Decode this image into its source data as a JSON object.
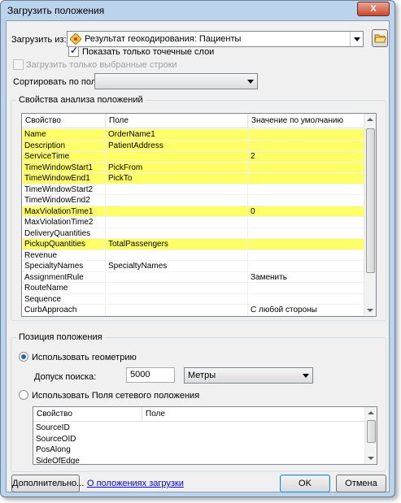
{
  "window": {
    "title": "Загрузить положения",
    "close_label": "X"
  },
  "load_from": {
    "label": "Загрузить из:",
    "value": "Результат геокодирования: Пациенты",
    "icon": "geocode-layer-icon"
  },
  "show_point_layers": {
    "label": "Показать только точечные слои",
    "checked": true
  },
  "load_selected_only": {
    "label": "Загрузить только выбранные строки",
    "checked": false,
    "enabled": false
  },
  "sort_by": {
    "label": "Сортировать по полю:",
    "value": ""
  },
  "properties_group": {
    "title": "Свойства анализа положений",
    "columns": [
      "Свойство",
      "Поле",
      "Значение по умолчанию"
    ],
    "rows": [
      {
        "property": "Name",
        "field": "OrderName1",
        "default": "",
        "highlight": true
      },
      {
        "property": "Description",
        "field": "PatientAddress",
        "default": "",
        "highlight": true
      },
      {
        "property": "ServiceTime",
        "field": "",
        "default": "2",
        "highlight": true
      },
      {
        "property": "TimeWindowStart1",
        "field": "PickFrom",
        "default": "",
        "highlight": true
      },
      {
        "property": "TimeWindowEnd1",
        "field": "PickTo",
        "default": "",
        "highlight": true
      },
      {
        "property": "TimeWindowStart2",
        "field": "",
        "default": "",
        "highlight": false
      },
      {
        "property": "TimeWindowEnd2",
        "field": "",
        "default": "",
        "highlight": false
      },
      {
        "property": "MaxViolationTime1",
        "field": "",
        "default": "0",
        "highlight": true
      },
      {
        "property": "MaxViolationTime2",
        "field": "",
        "default": "",
        "highlight": false
      },
      {
        "property": "DeliveryQuantities",
        "field": "",
        "default": "",
        "highlight": false
      },
      {
        "property": "PickupQuantities",
        "field": "TotalPassengers",
        "default": "",
        "highlight": true
      },
      {
        "property": "Revenue",
        "field": "",
        "default": "",
        "highlight": false
      },
      {
        "property": "SpecialtyNames",
        "field": "SpecialtyNames",
        "default": "",
        "highlight": false
      },
      {
        "property": "AssignmentRule",
        "field": "",
        "default": "Заменить",
        "highlight": false
      },
      {
        "property": "RouteName",
        "field": "",
        "default": "",
        "highlight": false
      },
      {
        "property": "Sequence",
        "field": "",
        "default": "",
        "highlight": false
      },
      {
        "property": "CurbApproach",
        "field": "",
        "default": "С любой стороны",
        "highlight": false
      }
    ]
  },
  "location_group": {
    "title": "Позиция положения",
    "use_geometry": {
      "label": "Использовать геометрию",
      "selected": true
    },
    "search_tolerance": {
      "label": "Допуск поиска:",
      "value": "5000",
      "units": "Метры"
    },
    "use_network_fields": {
      "label": "Использовать Поля сетевого положения",
      "selected": false
    },
    "columns": [
      "Свойство",
      "Поле"
    ],
    "rows": [
      {
        "property": "SourceID",
        "field": ""
      },
      {
        "property": "SourceOID",
        "field": ""
      },
      {
        "property": "PosAlong",
        "field": ""
      },
      {
        "property": "SideOfEdge",
        "field": ""
      }
    ]
  },
  "footer": {
    "advanced_label": "Дополнительно...",
    "about_link": "О положениях загрузки",
    "ok_label": "OK",
    "cancel_label": "Отмена"
  }
}
